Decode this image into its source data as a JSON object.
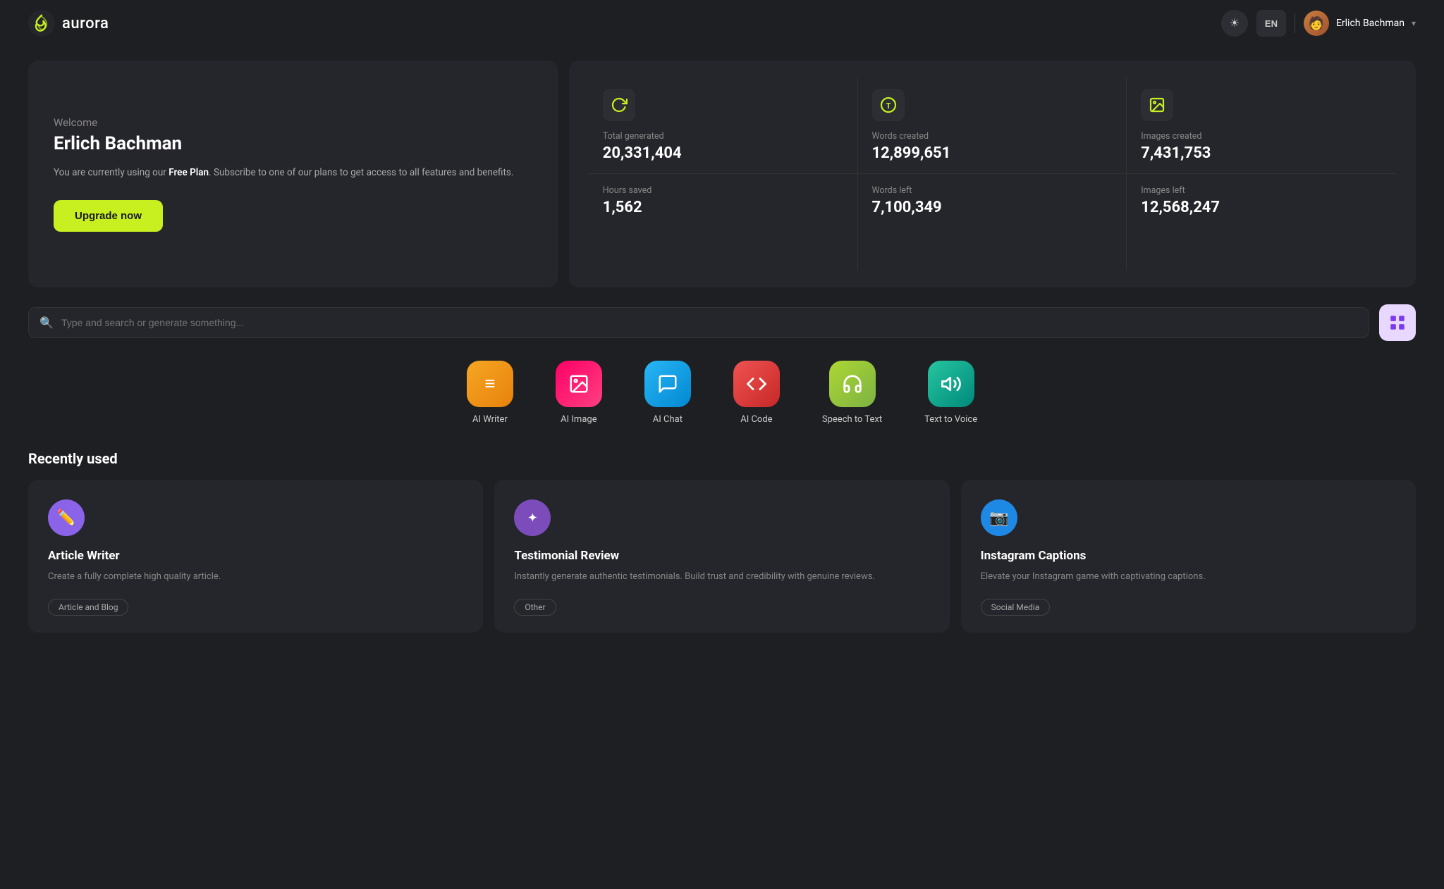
{
  "app": {
    "name": "aurora",
    "logo_alt": "aurora logo"
  },
  "header": {
    "theme_btn_label": "☀",
    "lang_label": "EN",
    "user_name": "Erlich Bachman",
    "chevron": "▾"
  },
  "welcome": {
    "label": "Welcome",
    "name": "Erlich Bachman",
    "desc_plain": "You are currently using our ",
    "desc_bold": "Free Plan",
    "desc_rest": ". Subscribe to one of our plans to get access to all features and benefits.",
    "upgrade_btn": "Upgrade now"
  },
  "stats": [
    {
      "label": "Total generated",
      "value": "20,331,404",
      "icon": "refresh"
    },
    {
      "label": "Words created",
      "value": "12,899,651",
      "icon": "text"
    },
    {
      "label": "Images created",
      "value": "7,431,753",
      "icon": "image"
    },
    {
      "label": "Hours saved",
      "value": "1,562",
      "icon": null
    },
    {
      "label": "Words left",
      "value": "7,100,349",
      "icon": null
    },
    {
      "label": "Images left",
      "value": "12,568,247",
      "icon": null
    }
  ],
  "search": {
    "placeholder": "Type and search or generate something..."
  },
  "tools": [
    {
      "label": "AI Writer",
      "class": "tool-writer",
      "icon": "≡"
    },
    {
      "label": "AI Image",
      "class": "tool-image",
      "icon": "🖼"
    },
    {
      "label": "AI Chat",
      "class": "tool-chat",
      "icon": "💬"
    },
    {
      "label": "AI Code",
      "class": "tool-code",
      "icon": "</>"
    },
    {
      "label": "Speech to Text",
      "class": "tool-speech",
      "icon": "🎧"
    },
    {
      "label": "Text to Voice",
      "class": "tool-voice",
      "icon": "🔊"
    }
  ],
  "recently_used": {
    "section_label": "Recently used",
    "cards": [
      {
        "title": "Article Writer",
        "desc": "Create a fully complete high quality article.",
        "tag": "Article and Blog",
        "icon_class": "icon-purple",
        "icon": "✏"
      },
      {
        "title": "Testimonial Review",
        "desc": "Instantly generate authentic testimonials. Build trust and credibility with genuine reviews.",
        "tag": "Other",
        "icon_class": "icon-violet",
        "icon": "✦"
      },
      {
        "title": "Instagram Captions",
        "desc": "Elevate your Instagram game with captivating captions.",
        "tag": "Social Media",
        "icon_class": "icon-blue",
        "icon": "📷"
      }
    ]
  }
}
